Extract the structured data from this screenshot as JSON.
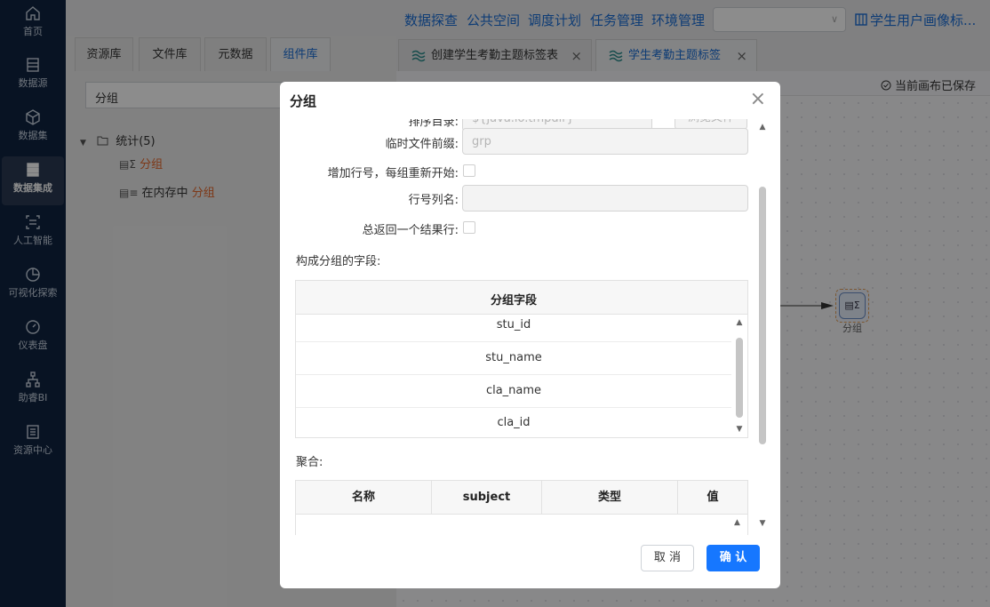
{
  "left_nav": {
    "items": [
      {
        "label": "首页",
        "icon": "home-icon"
      },
      {
        "label": "数据源",
        "icon": "database-source-icon"
      },
      {
        "label": "数据集",
        "icon": "cube-icon"
      },
      {
        "label": "数据集成",
        "icon": "data-integration-icon",
        "active": true
      },
      {
        "label": "人工智能",
        "icon": "ai-icon"
      },
      {
        "label": "可视化探索",
        "icon": "pie-chart-icon"
      },
      {
        "label": "仪表盘",
        "icon": "dashboard-gauge-icon"
      },
      {
        "label": "助睿BI",
        "icon": "org-chart-icon"
      },
      {
        "label": "资源中心",
        "icon": "resource-icon"
      }
    ]
  },
  "top_nav": {
    "links": [
      "数据探查",
      "公共空间",
      "调度计划",
      "任务管理",
      "环境管理"
    ],
    "select_value": "",
    "title": "学生用户画像标..."
  },
  "left_panel": {
    "tabs": [
      "资源库",
      "文件库",
      "元数据",
      "组件库"
    ],
    "active_tab": "组件库",
    "search_value": "分组",
    "tree": {
      "folder": "统计(5)",
      "items": [
        {
          "prefix": "",
          "highlight": "分组"
        },
        {
          "prefix": "在内存中 ",
          "highlight": "分组"
        }
      ]
    }
  },
  "editor": {
    "tabs": [
      {
        "label": "创建学生考勤主题标签表",
        "active": false
      },
      {
        "label": "学生考勤主题标签",
        "active": true
      }
    ],
    "saved_status": "当前画布已保存",
    "node_label": "分组"
  },
  "dialog": {
    "title": "分组",
    "fields": {
      "sort_dir_label": "排序目录:",
      "sort_dir_placeholder": "${java.io.tmpdir}",
      "browse_label": "浏览文件",
      "temp_prefix_label": "临时文件前缀:",
      "temp_prefix_placeholder": "grp",
      "add_line_label": "增加行号，每组重新开始:",
      "line_col_label": "行号列名:",
      "line_col_value": "",
      "always_one_label": "总返回一个结果行:"
    },
    "group_fields_section": "构成分组的字段:",
    "group_table": {
      "header": "分组字段",
      "rows": [
        "stu_id",
        "stu_name",
        "cla_name",
        "cla_id"
      ]
    },
    "aggregate_section": "聚合:",
    "agg_table": {
      "headers": [
        "名称",
        "subject",
        "类型",
        "值"
      ]
    },
    "cancel_label": "取 消",
    "ok_label": "确 认"
  },
  "colors": {
    "nav_bg": "#0f2340",
    "accent": "#1a6dd6",
    "primary_button": "#1677ff",
    "highlight_text": "#e4662a"
  }
}
